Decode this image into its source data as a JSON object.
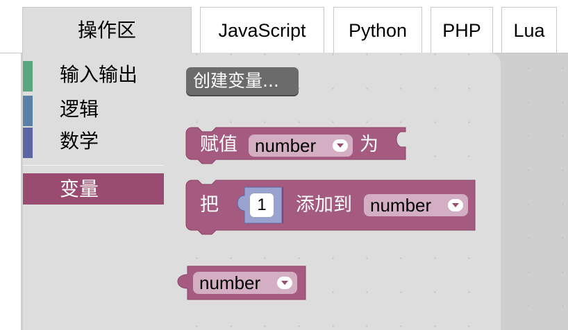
{
  "tabs": [
    {
      "label": "操作区",
      "active": true
    },
    {
      "label": "JavaScript",
      "active": false
    },
    {
      "label": "Python",
      "active": false
    },
    {
      "label": "PHP",
      "active": false
    },
    {
      "label": "Lua",
      "active": false
    }
  ],
  "toolbox": {
    "categories": [
      {
        "label": "输入输出",
        "color": "#5ba580",
        "selected": false
      },
      {
        "label": "逻辑",
        "color": "#5b80a5",
        "selected": false
      },
      {
        "label": "数学",
        "color": "#5b67a5",
        "selected": false
      },
      {
        "label": "变量",
        "color": "#a55b80",
        "selected": true
      }
    ]
  },
  "flyout": {
    "create_variable_label": "创建变量...",
    "set_block": {
      "prefix": "赋值",
      "variable": "number",
      "suffix": "为"
    },
    "change_block": {
      "prefix": "把",
      "amount": "1",
      "middle": "添加到",
      "variable": "number"
    },
    "getter_block": {
      "variable": "number"
    }
  },
  "colors": {
    "variable_block": "#a55b80",
    "variable_block_border": "#8c3f64",
    "number_block": "#5b67a5",
    "toolbox_bg": "#dddddd",
    "create_button": "#6b6b6b"
  }
}
